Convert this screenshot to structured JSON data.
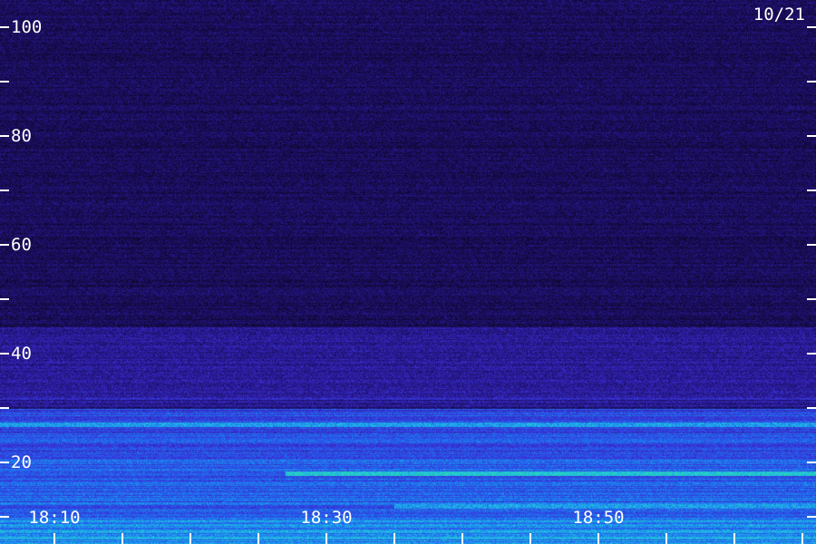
{
  "chart_data": {
    "type": "heatmap",
    "title": "",
    "date_label": "10/21",
    "xlabel": "",
    "ylabel": "",
    "x_time_range": [
      "18:06",
      "19:06"
    ],
    "x_minor_tick_interval_minutes": 5,
    "x_tick_labels": [
      "18:10",
      "18:30",
      "18:50"
    ],
    "x_tick_label_times": [
      "18:10",
      "18:30",
      "18:50"
    ],
    "ylim": [
      0,
      100
    ],
    "y_major_ticks": [
      20,
      40,
      60,
      80,
      100
    ],
    "y_minor_ticks": [
      10,
      30,
      50,
      70,
      90
    ],
    "colormap": [
      "#0d0629",
      "#22137a",
      "#3a2fd6",
      "#1e6df0",
      "#1fc0e6",
      "#2fe88c",
      "#c8f04a"
    ],
    "intensity_bands": [
      {
        "y_from": 0,
        "y_to": 10,
        "level": 0.55
      },
      {
        "y_from": 10,
        "y_to": 22,
        "level": 0.45
      },
      {
        "y_from": 22,
        "y_to": 30,
        "level": 0.4
      },
      {
        "y_from": 30,
        "y_to": 45,
        "level": 0.22
      },
      {
        "y_from": 45,
        "y_to": 100,
        "level": 0.1
      }
    ],
    "bright_lines": [
      {
        "y": 18,
        "level": 0.7,
        "time_from": "18:27",
        "time_to": "19:06"
      },
      {
        "y": 27,
        "level": 0.6,
        "time_from": "18:06",
        "time_to": "19:06"
      },
      {
        "y": 24,
        "level": 0.45,
        "time_from": "18:06",
        "time_to": "19:06"
      },
      {
        "y": 12,
        "level": 0.6,
        "time_from": "18:35",
        "time_to": "19:06"
      }
    ],
    "grid": false
  }
}
